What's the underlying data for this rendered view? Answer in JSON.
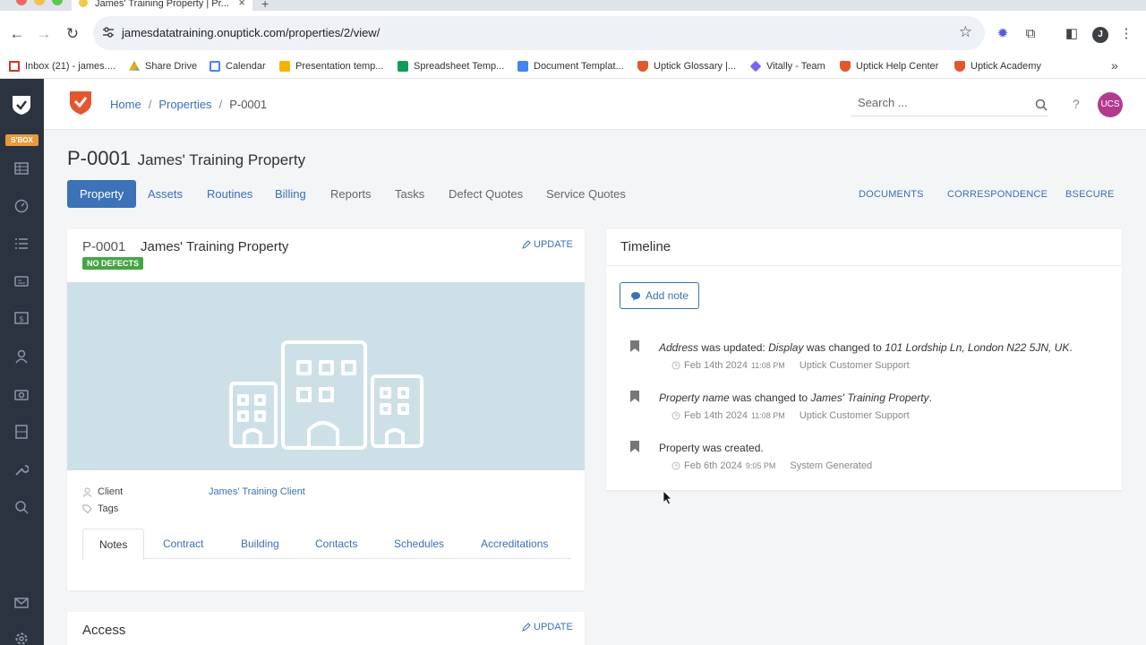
{
  "browser": {
    "tab_title": "James' Training Property | Pr...",
    "url": "jamesdatatraining.onuptick.com/properties/2/view/",
    "profile_initial": "J"
  },
  "bookmarks": [
    {
      "label": "Inbox (21) - james....",
      "color": "#d93025"
    },
    {
      "label": "Share Drive",
      "color": "#f4b400"
    },
    {
      "label": "Calendar",
      "color": "#4285f4"
    },
    {
      "label": "Presentation temp...",
      "color": "#f4b400"
    },
    {
      "label": "Spreadsheet Temp...",
      "color": "#0f9d58"
    },
    {
      "label": "Document Templat...",
      "color": "#4285f4"
    },
    {
      "label": "Uptick Glossary |...",
      "color": "#e4572e"
    },
    {
      "label": "Vitally - Team",
      "color": "#7b61ff"
    },
    {
      "label": "Uptick Help Center",
      "color": "#e4572e"
    },
    {
      "label": "Uptick Academy",
      "color": "#e4572e"
    }
  ],
  "app": {
    "sbox_label": "S'BOX",
    "breadcrumb": {
      "home": "Home",
      "properties": "Properties",
      "current": "P-0001",
      "separator": "/"
    },
    "search_placeholder": "Search ...",
    "help": "?",
    "avatar": "UCS"
  },
  "page": {
    "code": "P-0001",
    "name": "James' Training Property",
    "tabs": [
      "Property",
      "Assets",
      "Routines",
      "Billing",
      "Reports",
      "Tasks",
      "Defect Quotes",
      "Service Quotes"
    ],
    "right_links": [
      "DOCUMENTS",
      "CORRESPONDENCE",
      "BSECURE"
    ]
  },
  "property_card": {
    "code": "P-0001",
    "name": "James' Training Property",
    "update_label": "UPDATE",
    "badge": "NO DEFECTS",
    "client_label": "Client",
    "client_value": "James' Training Client",
    "tags_label": "Tags",
    "sub_tabs": [
      "Notes",
      "Contract",
      "Building",
      "Contacts",
      "Schedules",
      "Accreditations"
    ]
  },
  "access_card": {
    "title": "Access",
    "update_label": "UPDATE"
  },
  "timeline": {
    "title": "Timeline",
    "add_note": "Add note",
    "entries": [
      {
        "field": "Address",
        "mid1": " was updated: ",
        "sub_field": "Display",
        "mid2": " was changed to ",
        "value": "101 Lordship Ln, London N22 5JN, UK",
        "end": ".",
        "date": "Feb 14th 2024",
        "time": "11:08 PM",
        "who": "Uptick Customer Support"
      },
      {
        "field": "Property name",
        "mid2": " was changed to ",
        "value": "James' Training Property",
        "end": ".",
        "date": "Feb 14th 2024",
        "time": "11:08 PM",
        "who": "Uptick Customer Support"
      },
      {
        "text": "Property was created.",
        "date": "Feb 6th 2024",
        "time": "9:05 PM",
        "who": "System Generated"
      }
    ]
  },
  "colors": {
    "accent": "#3b72b8",
    "link": "#3b6fb6",
    "sidebar": "#2b3340",
    "badge": "#46a447",
    "brand": "#e4572e"
  }
}
